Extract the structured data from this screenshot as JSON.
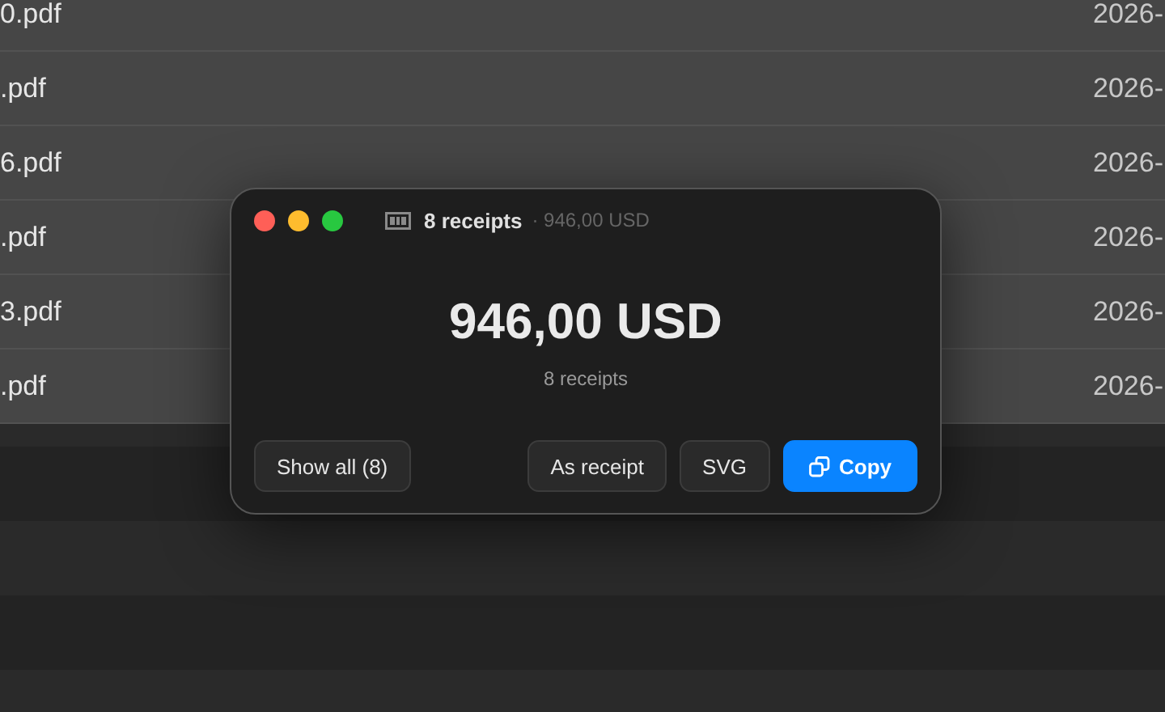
{
  "files": [
    {
      "name": "0.pdf",
      "date": "2026-"
    },
    {
      "name": ".pdf",
      "date": "2026-"
    },
    {
      "name": "6.pdf",
      "date": "2026-"
    },
    {
      "name": ".pdf",
      "date": "2026-"
    },
    {
      "name": "3.pdf",
      "date": "2026-"
    },
    {
      "name": ".pdf",
      "date": "2026-"
    }
  ],
  "popup": {
    "title": "8 receipts",
    "subtitle": "· 946,00 USD",
    "total": "946,00 USD",
    "caption": "8 receipts",
    "buttons": [
      {
        "label": "Show all (8)",
        "kind": "plain"
      },
      {
        "label": "As receipt",
        "kind": "plain"
      },
      {
        "label": "SVG",
        "kind": "plain"
      },
      {
        "label": "Copy",
        "kind": "primary"
      }
    ]
  }
}
